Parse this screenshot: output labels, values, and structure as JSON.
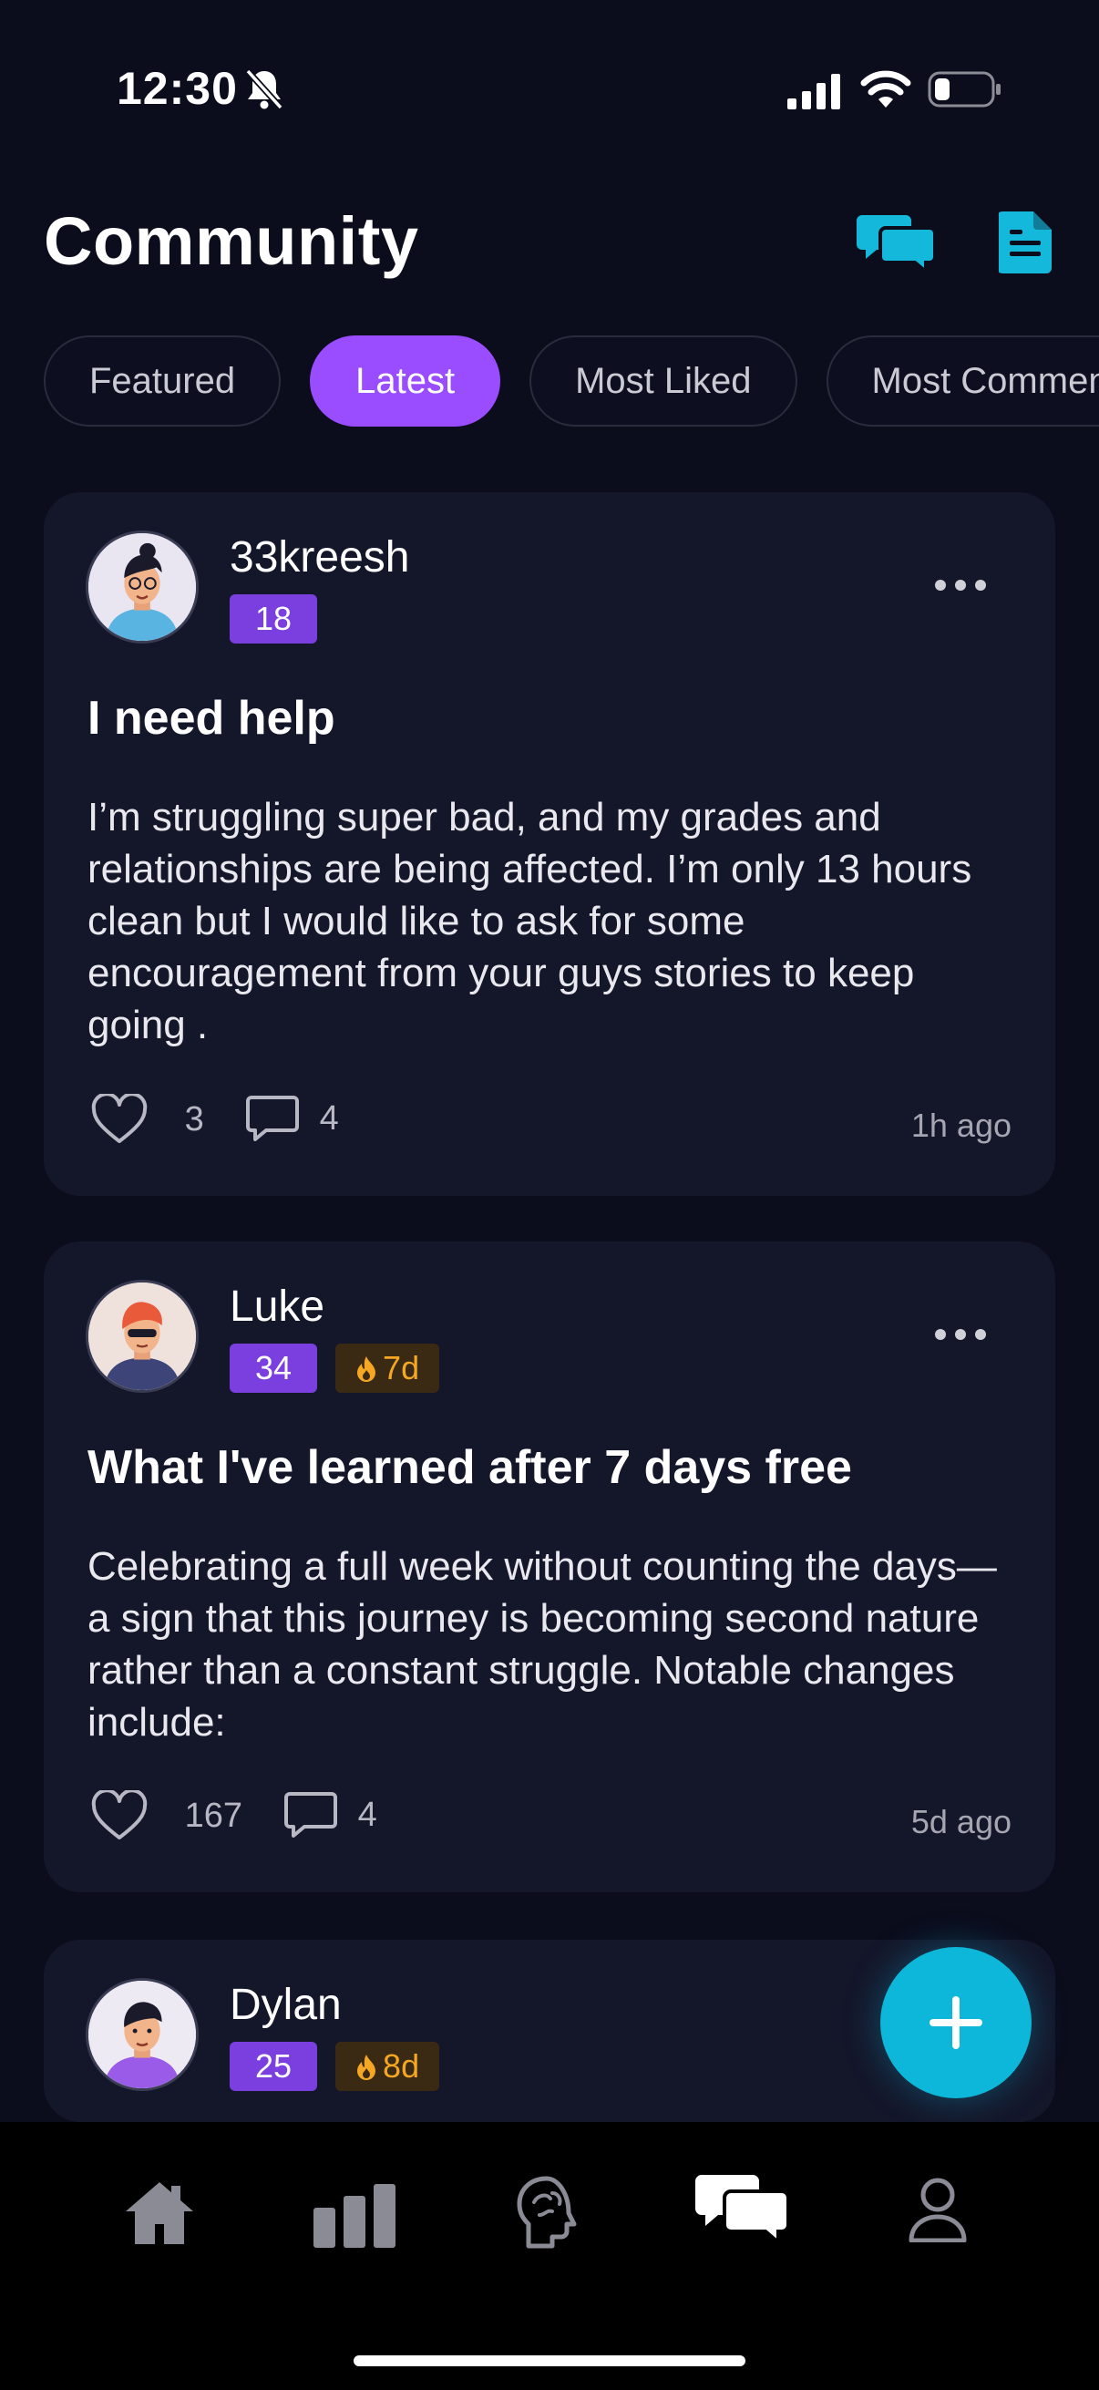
{
  "status_bar": {
    "time": "12:30"
  },
  "header": {
    "title": "Community"
  },
  "filters": [
    "Featured",
    "Latest",
    "Most Liked",
    "Most Commented"
  ],
  "active_filter": "Latest",
  "posts": [
    {
      "username": "33kreesh",
      "level": "18",
      "title": "I need help",
      "body": "I’m struggling super bad, and my grades and relationships are being affected. I’m only 13 hours clean but I would like to ask for some encouragement from your guys stories to keep going .",
      "likes": "3",
      "comments": "4",
      "time": "1h ago"
    },
    {
      "username": "Luke",
      "level": "34",
      "streak": "7d",
      "title": "What I've learned after 7 days free",
      "body": "Celebrating a full week without counting the days—a sign that this journey is becoming second nature rather than a constant struggle. Notable changes include:",
      "likes": "167",
      "comments": "4",
      "time": "5d ago"
    },
    {
      "username": "Dylan",
      "level": "25",
      "streak": "8d"
    }
  ],
  "colors": {
    "accent_purple": "#9a4cff",
    "accent_cyan": "#0db7d9",
    "background": "#0b0c1c",
    "card": "#14162a",
    "streak": "#f5a623"
  },
  "tabbar": [
    "home-icon",
    "stats-icon",
    "brain-icon",
    "community-icon",
    "profile-icon"
  ]
}
